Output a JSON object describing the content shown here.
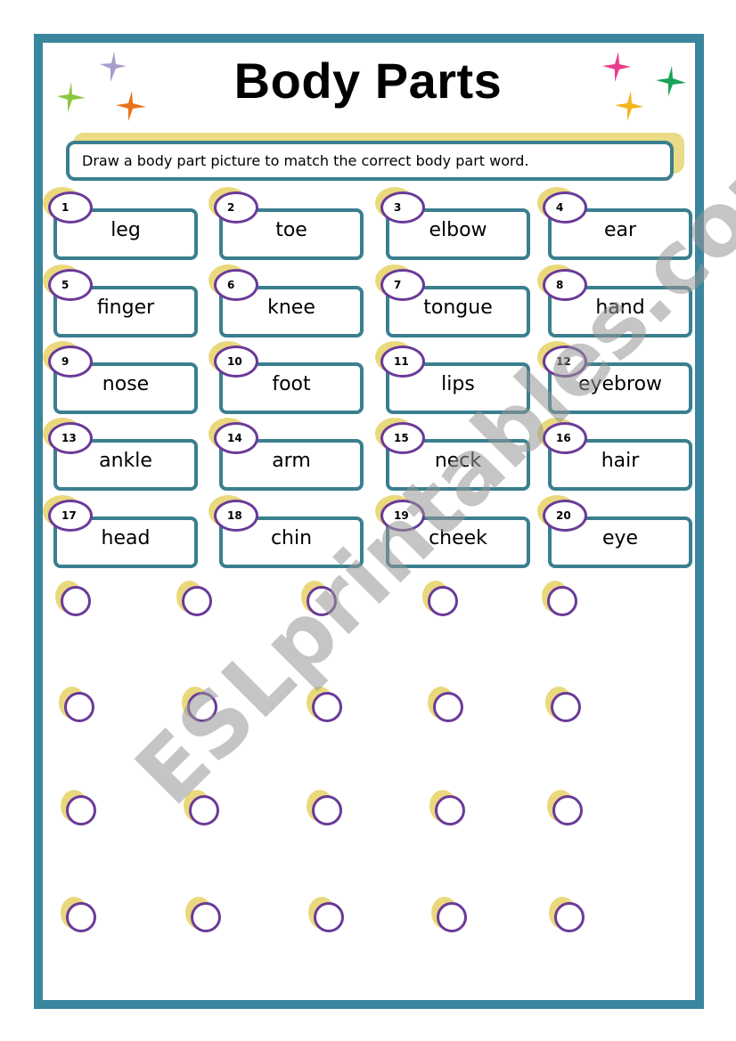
{
  "worksheet": {
    "title": "Body Parts",
    "instruction": "Draw a body part picture to match the correct body part word.",
    "watermark": "ESLprintables.com",
    "words": [
      {
        "number": "1",
        "word": "leg"
      },
      {
        "number": "2",
        "word": "toe"
      },
      {
        "number": "3",
        "word": "elbow"
      },
      {
        "number": "4",
        "word": "ear"
      },
      {
        "number": "5",
        "word": "finger"
      },
      {
        "number": "6",
        "word": "knee"
      },
      {
        "number": "7",
        "word": "tongue"
      },
      {
        "number": "8",
        "word": "hand"
      },
      {
        "number": "9",
        "word": "nose"
      },
      {
        "number": "10",
        "word": "foot"
      },
      {
        "number": "11",
        "word": "lips"
      },
      {
        "number": "12",
        "word": "eyebrow"
      },
      {
        "number": "13",
        "word": "ankle"
      },
      {
        "number": "14",
        "word": "arm"
      },
      {
        "number": "15",
        "word": "neck"
      },
      {
        "number": "16",
        "word": "hair"
      },
      {
        "number": "17",
        "word": "head"
      },
      {
        "number": "18",
        "word": "chin"
      },
      {
        "number": "19",
        "word": "cheek"
      },
      {
        "number": "20",
        "word": "eye"
      }
    ],
    "blank_circle_count": 20,
    "colors": {
      "frame": "#3a869e",
      "box_border": "#3a7f8f",
      "number_circle": "#6a3a98",
      "highlight": "#ead97c",
      "stars": [
        "#a99ccc",
        "#8cc63f",
        "#e8731b",
        "#e83e8c",
        "#1aa35a",
        "#f2b61e"
      ]
    }
  }
}
